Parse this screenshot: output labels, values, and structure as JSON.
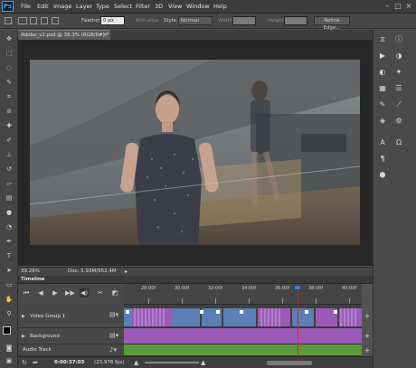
{
  "app": {
    "logo": "Ps"
  },
  "menu": {
    "items": [
      "File",
      "Edit",
      "Image",
      "Layer",
      "Type",
      "Select",
      "Filter",
      "3D",
      "View",
      "Window",
      "Help"
    ]
  },
  "options_bar": {
    "feather_label": "Feather:",
    "feather_value": "0 px",
    "antialias_label": "Anti-alias",
    "style_label": "Style:",
    "style_value": "Normal",
    "width_label": "Width:",
    "height_label": "Height:",
    "refine_edge_label": "Refine Edge..."
  },
  "document": {
    "tab_label": "Adobe_v2.psd @ 39.3% (RGB/8#) *"
  },
  "status": {
    "zoom": "39.26%",
    "doc_info": "Doc: 5.93M/952.4M"
  },
  "timeline": {
    "title": "Timeline",
    "ruler_labels": [
      "28:00f",
      "30:00f",
      "32:00f",
      "34:00f",
      "36:00f",
      "38:00f",
      "40:00f"
    ],
    "tracks": [
      {
        "name": "Video Group 1"
      },
      {
        "name": "Background"
      },
      {
        "name": "Audio Track"
      }
    ],
    "current_time": "0:00:37:03",
    "fps": "(23.976 fps)",
    "playhead_seconds": 37.1,
    "ruler_start_seconds": 27.0,
    "ruler_end_seconds": 41.0
  },
  "colors": {
    "video_clip": "#5b7fb6",
    "purple_track": "#9b5ab8",
    "audio_track": "#5a9a3a",
    "playhead": "#e02020"
  }
}
